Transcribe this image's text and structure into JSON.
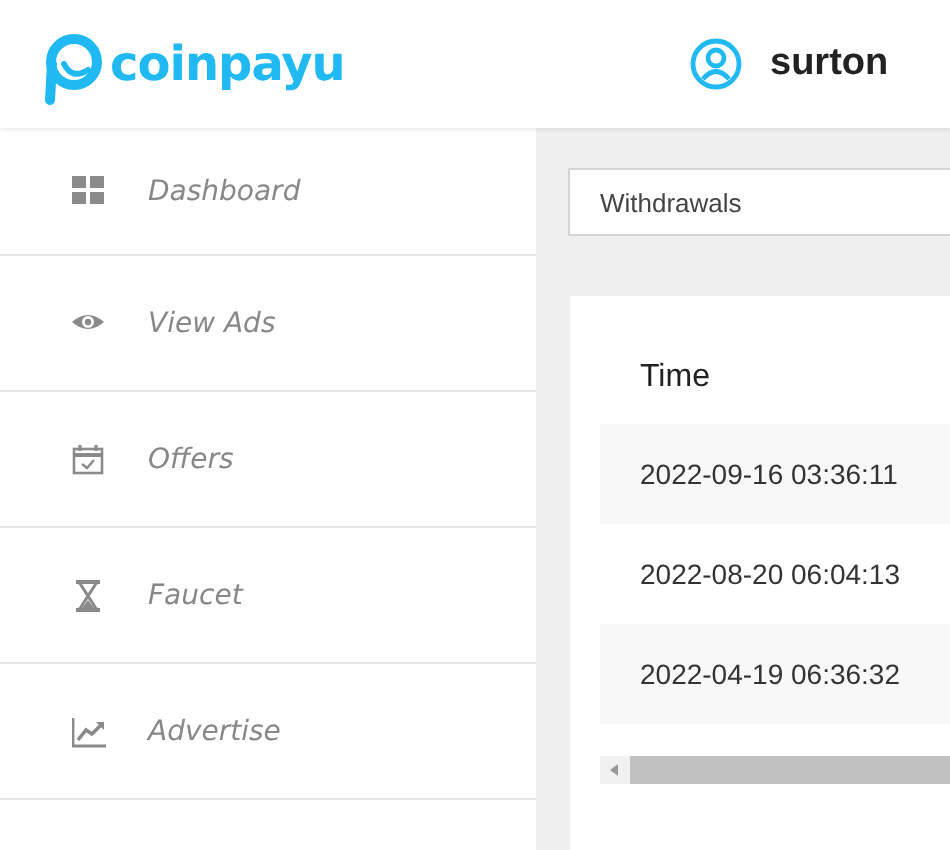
{
  "header": {
    "logo_text": "coinpayu",
    "username": "surton"
  },
  "sidebar": {
    "items": [
      {
        "label": "Dashboard"
      },
      {
        "label": "View Ads"
      },
      {
        "label": "Offers"
      },
      {
        "label": "Faucet"
      },
      {
        "label": "Advertise"
      }
    ]
  },
  "filter": {
    "value": "Withdrawals"
  },
  "table": {
    "columns": [
      "Time"
    ],
    "rows": [
      [
        "2022-09-16 03:36:11"
      ],
      [
        "2022-08-20 06:04:13"
      ],
      [
        "2022-04-19 06:36:32"
      ]
    ]
  }
}
